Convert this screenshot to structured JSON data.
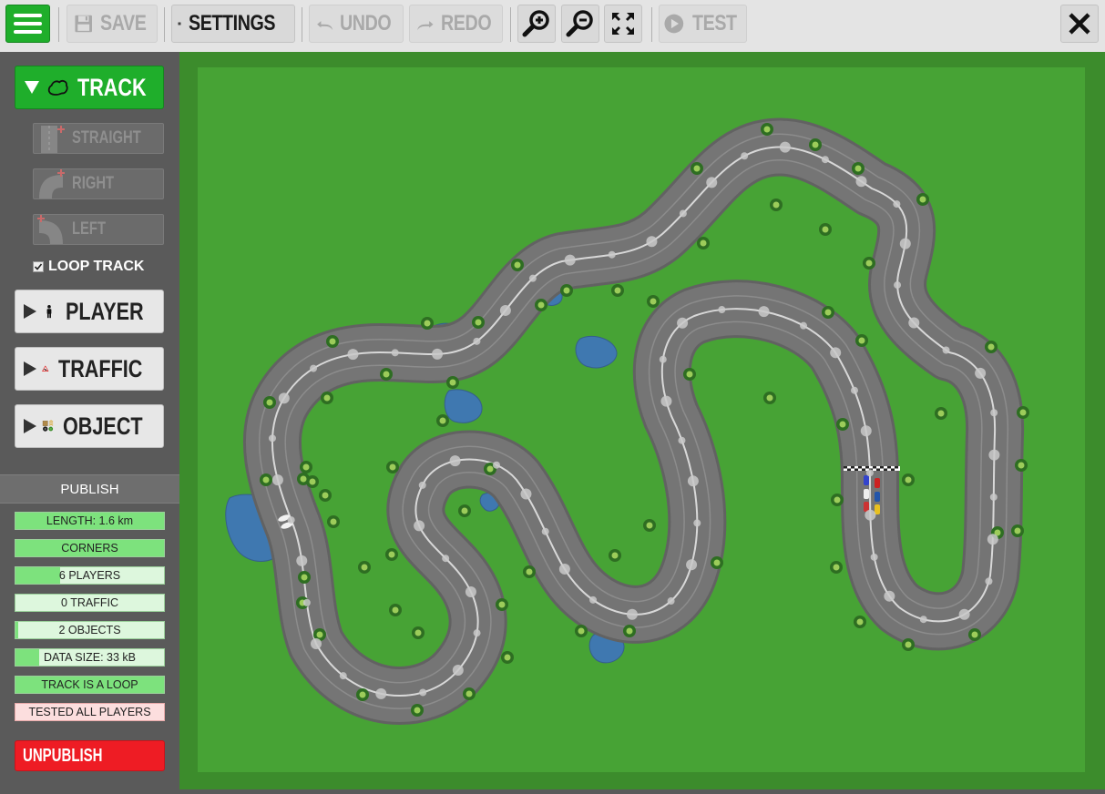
{
  "toolbar": {
    "menu_icon": "hamburger-menu-icon",
    "save_label": "SAVE",
    "settings_label": "SETTINGS",
    "undo_label": "UNDO",
    "redo_label": "REDO",
    "test_label": "TEST"
  },
  "sidebar": {
    "track_label": "TRACK",
    "straight_label": "STRAIGHT",
    "right_label": "RIGHT",
    "left_label": "LEFT",
    "loop_track_label": "LOOP TRACK",
    "loop_track_checked": true,
    "player_label": "PLAYER",
    "traffic_label": "TRAFFIC",
    "object_label": "OBJECT"
  },
  "publish": {
    "header": "PUBLISH",
    "stats": [
      {
        "text": "LENGTH: 1.6 km",
        "fill": 1.0,
        "ok": true
      },
      {
        "text": "CORNERS",
        "fill": 1.0,
        "ok": true
      },
      {
        "text": "6 PLAYERS",
        "fill": 0.3,
        "ok": true
      },
      {
        "text": "0 TRAFFIC",
        "fill": 0.0,
        "ok": true
      },
      {
        "text": "2 OBJECTS",
        "fill": 0.02,
        "ok": true
      },
      {
        "text": "DATA SIZE: 33 kB",
        "fill": 0.16,
        "ok": true
      },
      {
        "text": "TRACK IS A LOOP",
        "fill": 1.0,
        "ok": true
      },
      {
        "text": "TESTED ALL PLAYERS",
        "fill": 0.0,
        "ok": false
      }
    ],
    "unpublish_label": "UNPUBLISH"
  },
  "colors": {
    "accent_green": "#1fae2b",
    "grass": "#3d8f2d",
    "grass_inner": "#47a335",
    "track": "#737373",
    "water": "#3f78b0",
    "danger": "#ee1c24"
  }
}
